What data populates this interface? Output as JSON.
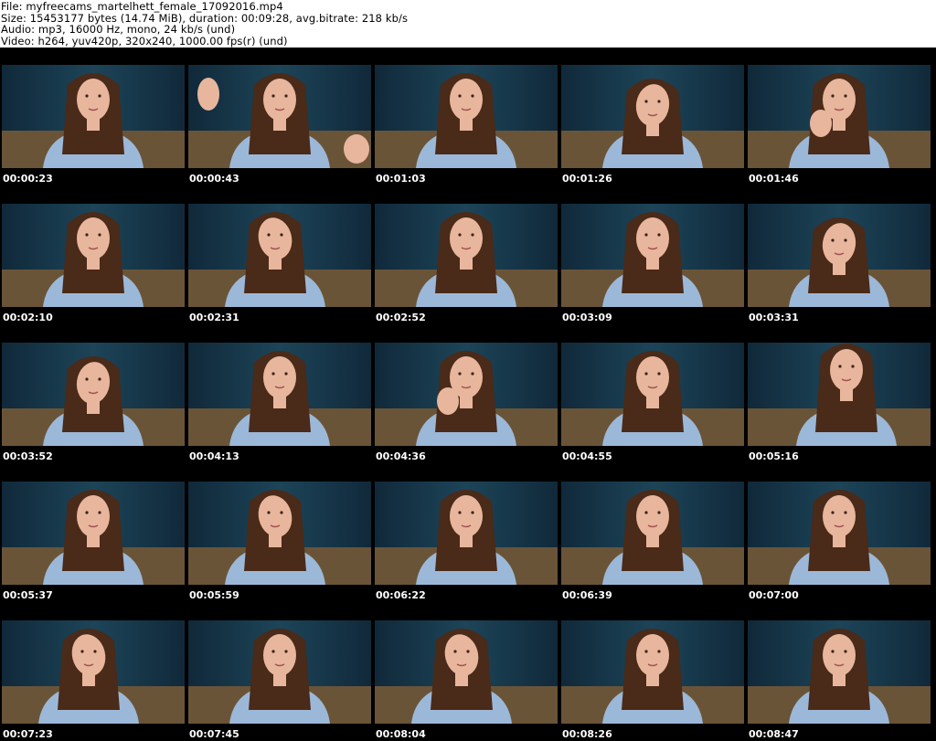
{
  "info": {
    "file": "File: myfreecams_martelhett_female_17092016.mp4",
    "size": "Size: 15453177 bytes (14.74 MiB), duration: 00:09:28, avg.bitrate: 218 kb/s",
    "audio": "Audio: mp3, 16000 Hz, mono, 24 kb/s (und)",
    "video": "Video: h264, yuv420p, 320x240, 1000.00 fps(r) (und)"
  },
  "colors": {
    "grid_background": "#000000",
    "timestamp_text": "#ffffff",
    "wall": "#1d4458",
    "wall_dark": "#10293a",
    "bed": "#6a5438",
    "hair": "#4a2a18",
    "skin": "#e8b69c",
    "shirt": "#9cb8d8"
  },
  "thumbnails": [
    {
      "time": "00:00:23",
      "pose": "center"
    },
    {
      "time": "00:00:43",
      "pose": "hands"
    },
    {
      "time": "00:01:03",
      "pose": "center"
    },
    {
      "time": "00:01:26",
      "pose": "down"
    },
    {
      "time": "00:01:46",
      "pose": "hand-chin"
    },
    {
      "time": "00:02:10",
      "pose": "center"
    },
    {
      "time": "00:02:31",
      "pose": "tilt"
    },
    {
      "time": "00:02:52",
      "pose": "center"
    },
    {
      "time": "00:03:09",
      "pose": "center"
    },
    {
      "time": "00:03:31",
      "pose": "down"
    },
    {
      "time": "00:03:52",
      "pose": "down"
    },
    {
      "time": "00:04:13",
      "pose": "center"
    },
    {
      "time": "00:04:36",
      "pose": "hand-chin"
    },
    {
      "time": "00:04:55",
      "pose": "center"
    },
    {
      "time": "00:05:16",
      "pose": "high"
    },
    {
      "time": "00:05:37",
      "pose": "center"
    },
    {
      "time": "00:05:59",
      "pose": "tilt"
    },
    {
      "time": "00:06:22",
      "pose": "center"
    },
    {
      "time": "00:06:39",
      "pose": "center"
    },
    {
      "time": "00:07:00",
      "pose": "center"
    },
    {
      "time": "00:07:23",
      "pose": "tilt"
    },
    {
      "time": "00:07:45",
      "pose": "center"
    },
    {
      "time": "00:08:04",
      "pose": "tilt"
    },
    {
      "time": "00:08:26",
      "pose": "center"
    },
    {
      "time": "00:08:47",
      "pose": "center"
    }
  ]
}
